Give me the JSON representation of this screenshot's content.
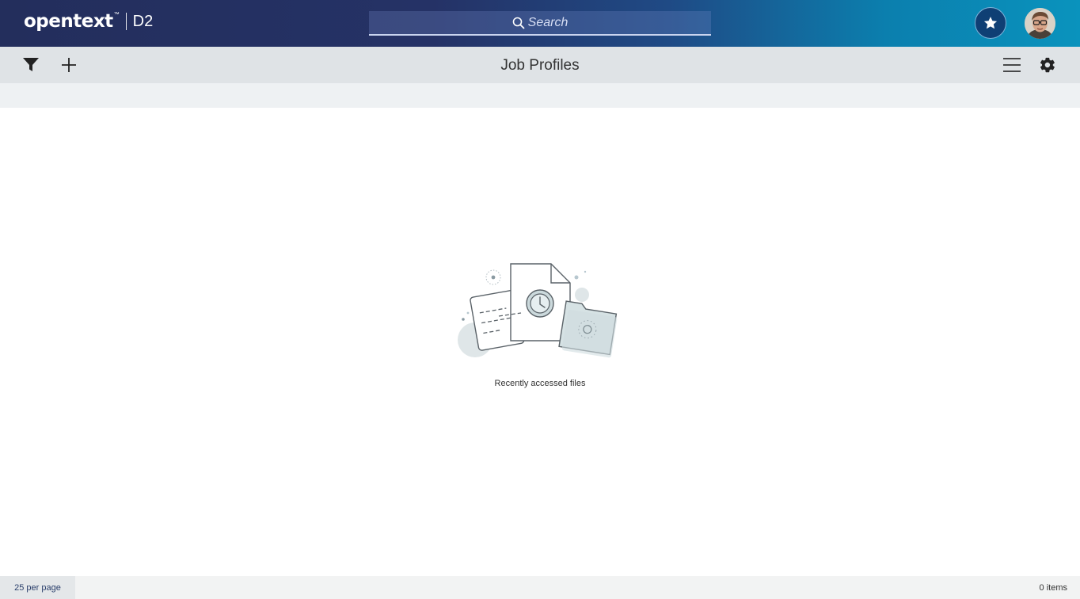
{
  "header": {
    "brand_logo": "opentext",
    "brand_tm": "™",
    "product": "D2",
    "search_placeholder": "Search",
    "favorites_icon": "star-icon",
    "avatar_icon": "user-avatar"
  },
  "toolbar": {
    "filter_icon": "filter-icon",
    "add_icon": "plus-icon",
    "title": "Job Profiles",
    "menu_icon": "hamburger-menu-icon",
    "settings_icon": "gear-icon"
  },
  "empty_state": {
    "illustration": "recent-files-illustration",
    "label": "Recently accessed files"
  },
  "footer": {
    "per_page": "25 per page",
    "item_count": "0 items"
  },
  "colors": {
    "header_start": "#232e5c",
    "header_end": "#0a93bd",
    "toolbar_bg": "#dfe3e6",
    "subbar_bg": "#eef1f3"
  }
}
